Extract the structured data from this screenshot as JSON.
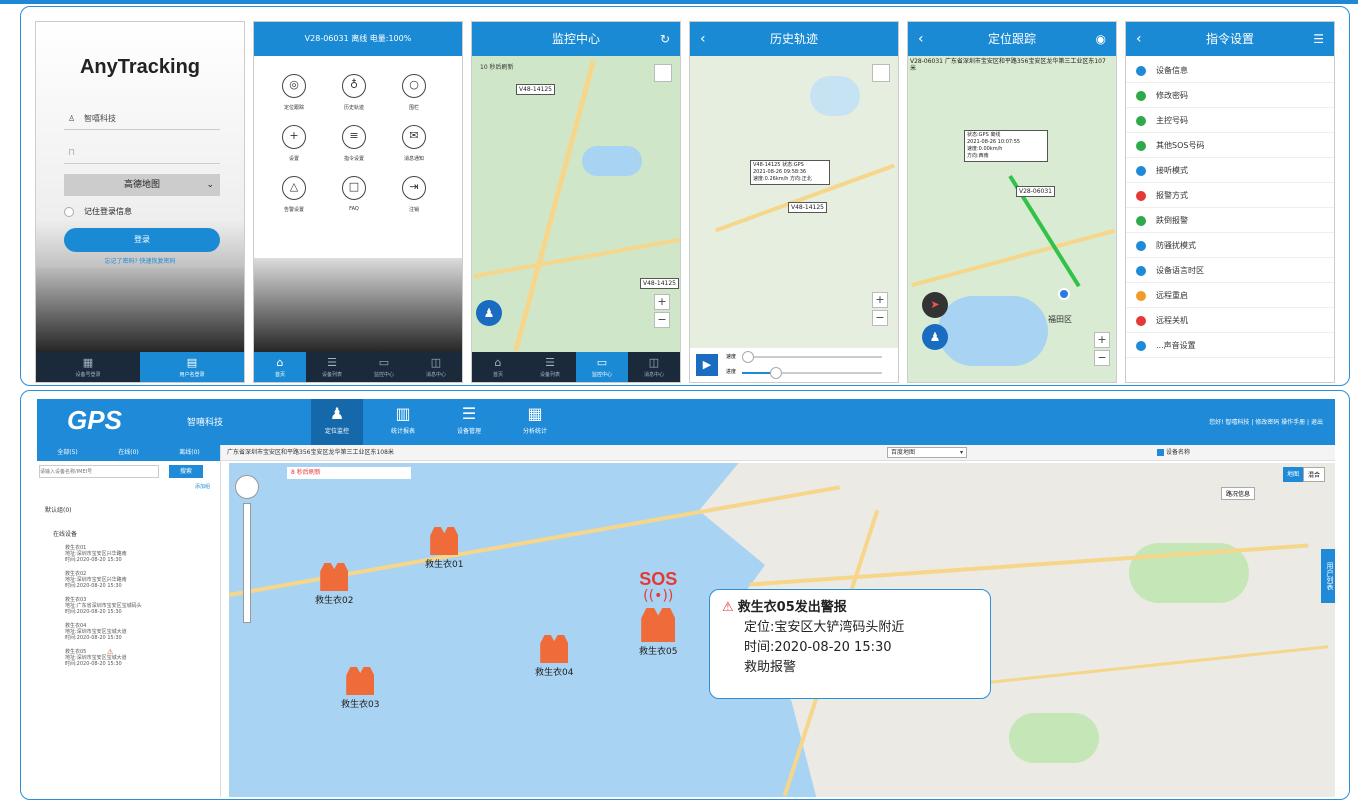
{
  "screens": {
    "login": {
      "logo": "AnyTracking",
      "username": "智嘻科技",
      "map_select": "高德地图",
      "remember": "记住登录信息",
      "login_button": "登录",
      "forgot": "忘记了密码? 快速恢复密码",
      "nav": [
        "设备号登录",
        "用户名登录"
      ]
    },
    "home": {
      "title": "V28-06031 离线 电量:100%",
      "icons": [
        "定位跟踪",
        "历史轨迹",
        "围栏",
        "设置",
        "指令设置",
        "消息通知",
        "告警设置",
        "FAQ",
        "注销"
      ],
      "nav": [
        "首页",
        "设备列表",
        "监控中心",
        "消息中心"
      ]
    },
    "monitor": {
      "title": "监控中心",
      "scale": "10 秒后刷新",
      "marker": "V48-14125",
      "nav": [
        "首页",
        "设备列表",
        "监控中心",
        "消息中心"
      ]
    },
    "history": {
      "title": "历史轨迹",
      "marker": "V48-14125",
      "info": [
        "V48-14125 状态:GPS",
        "2021-08-26 09:58:36",
        "速度:0.26km/h 方向:正北"
      ],
      "speed_label": "速度",
      "progress_label": "进度"
    },
    "track": {
      "title": "定位跟踪",
      "address": "V28-06031 广东省深圳市宝安区和平路356宝安区龙华第三工业区东107米",
      "marker": "V28-06031",
      "info": [
        "状态:GPS 离线",
        "2021-08-26 10:07:55",
        "速度:0.00km/h",
        "方向:西南"
      ],
      "district": "福田区"
    },
    "commands": {
      "title": "指令设置",
      "items": [
        "设备信息",
        "修改密码",
        "主控号码",
        "其他SOS号码",
        "接听模式",
        "报警方式",
        "跌倒报警",
        "防骚扰模式",
        "设备语言时区",
        "远程重启",
        "远程关机",
        "...声音设置"
      ],
      "colors": [
        "#1e8ad8",
        "#2eaa4a",
        "#2eaa4a",
        "#2eaa4a",
        "#1e8ad8",
        "#e53935",
        "#2eaa4a",
        "#1e8ad8",
        "#1e8ad8",
        "#f29b2a",
        "#e53935",
        "#1e8ad8"
      ]
    }
  },
  "web": {
    "logo": "GPS",
    "company": "智嘻科技",
    "nav": [
      "定位监控",
      "统计报表",
      "设备管理",
      "分析统计"
    ],
    "header_right": "您好! 智嘻科技 | 修改密码 操作手册 | 退出",
    "tabs": {
      "all": "全部(5)",
      "online": "在线(0)",
      "offline": "离线(0)"
    },
    "search_placeholder": "请输入设备名称/IMEI号",
    "search_button": "搜索",
    "add_group": "添加组",
    "group": "默认组(0)",
    "online_label": "在线设备",
    "devices": [
      {
        "name": "救生衣01",
        "addr": "地址:深圳市宝安区兴华路南",
        "time": "时间:2020-08-20 15:30"
      },
      {
        "name": "救生衣02",
        "addr": "地址:深圳市宝安区兴华路南",
        "time": "时间:2020-08-20 15:30"
      },
      {
        "name": "救生衣03",
        "addr": "地址:广东省深圳市宝安区宝城码头",
        "time": "时间:2020-08-20 15:30"
      },
      {
        "name": "救生衣04",
        "addr": "地址:深圳市宝安区宝城大道",
        "time": "时间:2020-08-20 15:30"
      },
      {
        "name": "救生衣05",
        "addr": "地址:深圳市宝安区宝城大道",
        "time": "时间:2020-08-20 15:30"
      }
    ],
    "address_bar": "广东省深圳市宝安区和平路356宝安区龙华第三工业区东108米",
    "map_type": "百度地图",
    "show_names": "设备名称",
    "refresh": "8 秒后刷新",
    "map_buttons": [
      "地图",
      "混合"
    ],
    "traffic": "路况信息",
    "user_list": "用户列表",
    "vests": [
      "救生衣01",
      "救生衣02",
      "救生衣03",
      "救生衣04",
      "救生衣05"
    ],
    "sos": "SOS",
    "alert": {
      "title": "救生衣05发出警报",
      "location": "定位:宝安区大铲湾码头附近",
      "time": "时间:2020-08-20 15:30",
      "type": "救助报警"
    }
  }
}
